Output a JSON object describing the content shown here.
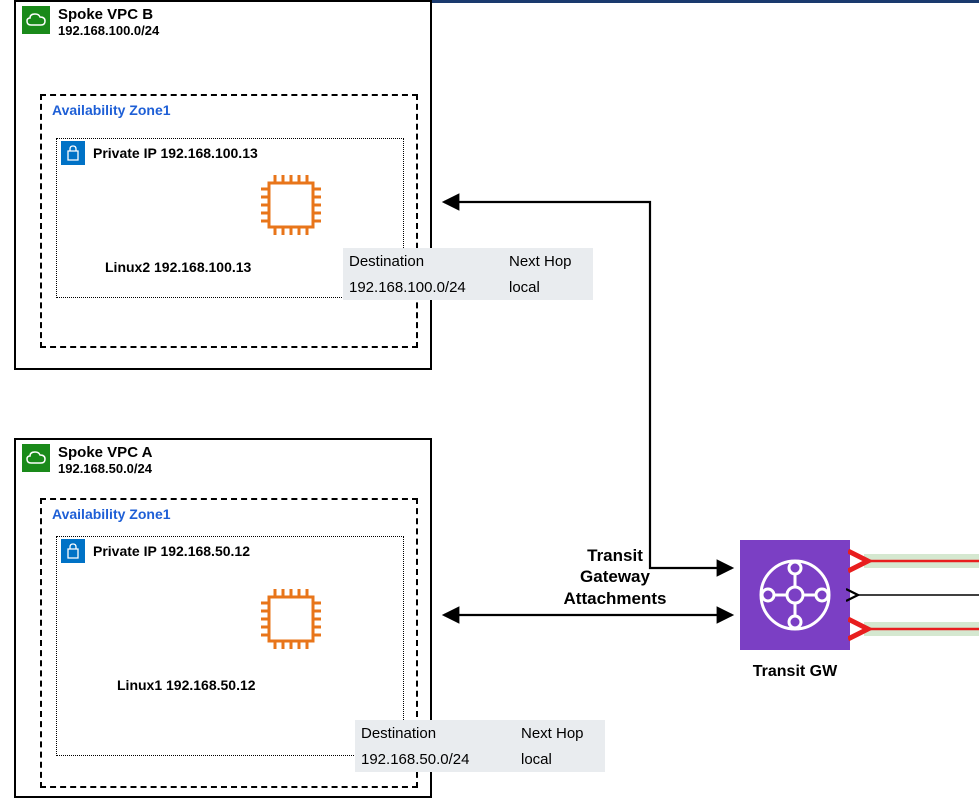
{
  "top_border_color": "#1a3a6e",
  "vpc_b": {
    "title": "Spoke VPC B",
    "cidr": "192.168.100.0/24",
    "az": "Availability Zone1",
    "subnet_label": "Private IP  192.168.100.13",
    "instance": "Linux2   192.168.100.13",
    "route": {
      "h1": "Destination",
      "h2": "Next Hop",
      "d": "192.168.100.0/24",
      "nh": "local"
    }
  },
  "vpc_a": {
    "title": "Spoke VPC A",
    "cidr": "192.168.50.0/24",
    "az": "Availability Zone1",
    "subnet_label": "Private IP  192.168.50.12",
    "instance": "Linux1   192.168.50.12",
    "route": {
      "h1": "Destination",
      "h2": "Next Hop",
      "d": "192.168.50.0/24",
      "nh": "local"
    }
  },
  "tgw": {
    "attach_label": "Transit\nGateway\nAttachments",
    "label": "Transit GW"
  }
}
